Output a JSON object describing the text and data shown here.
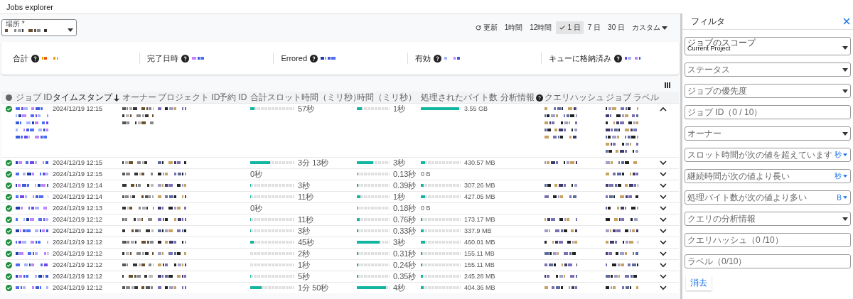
{
  "page": {
    "title": "Jobs explorer"
  },
  "location": {
    "label": "場所 *"
  },
  "toolbar": {
    "refresh": "更新",
    "ranges": [
      {
        "label": "1時間",
        "selected": false,
        "kind": "preset"
      },
      {
        "label": "12時間",
        "selected": false,
        "kind": "preset"
      },
      {
        "label": "1 日",
        "selected": true,
        "kind": "preset"
      },
      {
        "label": "7 日",
        "selected": false,
        "kind": "preset"
      },
      {
        "label": "30 日",
        "selected": false,
        "kind": "preset"
      },
      {
        "label": "カスタム",
        "selected": false,
        "kind": "dropdown"
      }
    ]
  },
  "metrics": [
    {
      "label": "合計"
    },
    {
      "label": "完了日時"
    },
    {
      "label": "Errored"
    },
    {
      "label": "有効"
    },
    {
      "label": "キューに格納済み"
    }
  ],
  "table": {
    "columns": [
      {
        "label": "ジョブ ID",
        "sorted": false,
        "help": false
      },
      {
        "label": "タイムスタンプ",
        "sorted": true,
        "help": false
      },
      {
        "label": "オーナー",
        "sorted": false,
        "help": false
      },
      {
        "label": "プロジェクト ID",
        "sorted": false,
        "help": false
      },
      {
        "label": "予約 ID",
        "sorted": false,
        "help": false
      },
      {
        "label": "合計スロット時間（ミリ秒）",
        "sorted": false,
        "help": false
      },
      {
        "label": "時間（ミリ秒）",
        "sorted": false,
        "help": false
      },
      {
        "label": "処理されたバイト数",
        "sorted": false,
        "help": false
      },
      {
        "label": "分析情報",
        "sorted": false,
        "help": true
      },
      {
        "label": "クエリハッシュ",
        "sorted": false,
        "help": false
      },
      {
        "label": "ジョブ ラベル",
        "sorted": false,
        "help": false
      }
    ],
    "rows": [
      {
        "succeeded": true,
        "timestamp": "2024/12/19 12:15",
        "slot": {
          "level": 0.1,
          "text": "57秒"
        },
        "duration": {
          "level": 0.15,
          "text": "1秒"
        },
        "bytes": {
          "level": 0.97,
          "text": "3.55 GB"
        },
        "hash_shown": true,
        "expanded": true
      },
      {
        "succeeded": true,
        "timestamp": "2024/12/19 12:15",
        "slot": {
          "level": 0.45,
          "text": "3分 13秒"
        },
        "duration": {
          "level": 0.5,
          "text": "3秒"
        },
        "bytes": {
          "level": 0.1,
          "text": "430.57 MB"
        },
        "hash_shown": true,
        "expanded": false
      },
      {
        "succeeded": true,
        "timestamp": "2024/12/19 12:15",
        "slot": {
          "text": "0秒"
        },
        "duration": {
          "level": 0.02,
          "text": "0.13秒"
        },
        "bytes": {
          "text": "0 B"
        },
        "hash_shown": false,
        "expanded": false
      },
      {
        "succeeded": true,
        "timestamp": "2024/12/19 12:14",
        "slot": {
          "level": 0.01,
          "text": "3秒"
        },
        "duration": {
          "level": 0.05,
          "text": "0.39秒"
        },
        "bytes": {
          "level": 0.08,
          "text": "307.26 MB"
        },
        "hash_shown": true,
        "expanded": false
      },
      {
        "succeeded": true,
        "timestamp": "2024/12/19 12:14",
        "slot": {
          "level": 0.01,
          "text": "11秒"
        },
        "duration": {
          "level": 0.1,
          "text": "1秒"
        },
        "bytes": {
          "level": 0.1,
          "text": "427.05 MB"
        },
        "hash_shown": true,
        "expanded": false
      },
      {
        "succeeded": true,
        "timestamp": "2024/12/19 12:13",
        "slot": {
          "text": "0秒"
        },
        "duration": {
          "level": 0.02,
          "text": "0.18秒"
        },
        "bytes": {
          "text": "0 B"
        },
        "hash_shown": false,
        "expanded": false
      },
      {
        "succeeded": true,
        "timestamp": "2024/12/19 12:12",
        "slot": {
          "level": 0.01,
          "text": "11秒"
        },
        "duration": {
          "level": 0.08,
          "text": "0.76秒"
        },
        "bytes": {
          "level": 0.03,
          "text": "173.17 MB"
        },
        "hash_shown": true,
        "expanded": false
      },
      {
        "succeeded": true,
        "timestamp": "2024/12/19 12:12",
        "slot": {
          "level": 0.01,
          "text": "3秒"
        },
        "duration": {
          "level": 0.04,
          "text": "0.33秒"
        },
        "bytes": {
          "level": 0.08,
          "text": "337.9 MB"
        },
        "hash_shown": true,
        "expanded": false
      },
      {
        "succeeded": true,
        "timestamp": "2024/12/19 12:12",
        "slot": {
          "level": 0.08,
          "text": "45秒"
        },
        "duration": {
          "level": 0.7,
          "text": "3秒"
        },
        "bytes": {
          "level": 0.1,
          "text": "460.01 MB"
        },
        "hash_shown": true,
        "expanded": false
      },
      {
        "succeeded": true,
        "timestamp": "2024/12/19 12:12",
        "slot": {
          "level": 0,
          "text": "2秒"
        },
        "duration": {
          "level": 0.04,
          "text": "0.31秒"
        },
        "bytes": {
          "level": 0.03,
          "text": "155.11 MB"
        },
        "hash_shown": true,
        "expanded": false
      },
      {
        "succeeded": true,
        "timestamp": "2024/12/19 12:12",
        "slot": {
          "level": 0,
          "text": "1秒"
        },
        "duration": {
          "level": 0.04,
          "text": "0.24秒"
        },
        "bytes": {
          "level": 0.03,
          "text": "155.11 MB"
        },
        "hash_shown": true,
        "expanded": false
      },
      {
        "succeeded": true,
        "timestamp": "2024/12/19 12:12",
        "slot": {
          "level": 0.01,
          "text": "5秒"
        },
        "duration": {
          "level": 0.04,
          "text": "0.35秒"
        },
        "bytes": {
          "level": 0.05,
          "text": "245.28 MB"
        },
        "hash_shown": true,
        "expanded": false
      },
      {
        "succeeded": true,
        "timestamp": "2024/12/19 12:12",
        "slot": {
          "level": 0.25,
          "text": "1分 50秒"
        },
        "duration": {
          "level": 0.9,
          "text": "4秒"
        },
        "bytes": {
          "level": 0.08,
          "text": "404.36 MB"
        },
        "hash_shown": true,
        "expanded": false
      }
    ]
  },
  "filter": {
    "title": "フィルタ",
    "fields": [
      {
        "kind": "select",
        "label": "ジョブのスコープ",
        "value": "Current Project"
      },
      {
        "kind": "select",
        "placeholder": "ステータス"
      },
      {
        "kind": "select",
        "placeholder": "ジョブの優先度"
      },
      {
        "kind": "input",
        "placeholder": "ジョブ ID（0 / 10）"
      },
      {
        "kind": "select",
        "placeholder": "オーナー"
      },
      {
        "kind": "unit",
        "placeholder": "スロット時間が次の値を超えています",
        "unit": "秒"
      },
      {
        "kind": "unit",
        "placeholder": "継続時間が次の値より長い",
        "unit": "秒"
      },
      {
        "kind": "unit",
        "placeholder": "処理バイト数が次の値より多い",
        "unit": "B"
      },
      {
        "kind": "select",
        "placeholder": "クエリの分析情報"
      },
      {
        "kind": "input",
        "placeholder": "クエリハッシュ（0 /10）"
      },
      {
        "kind": "input",
        "placeholder": "ラベル（0/10）"
      }
    ],
    "clear": "消去"
  }
}
